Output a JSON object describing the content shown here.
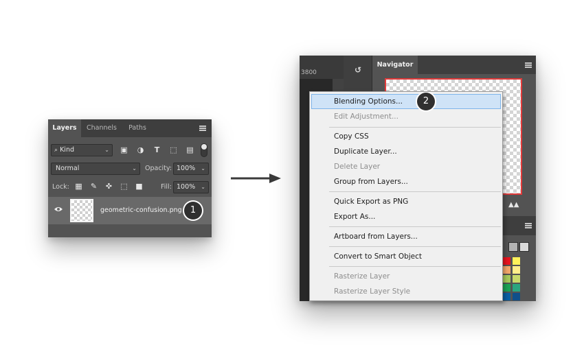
{
  "layers_panel": {
    "tabs": [
      {
        "label": "Layers",
        "active": true
      },
      {
        "label": "Channels",
        "active": false
      },
      {
        "label": "Paths",
        "active": false
      }
    ],
    "kind_filter": {
      "value": "Kind"
    },
    "blend_mode": {
      "value": "Normal"
    },
    "opacity": {
      "label": "Opacity:",
      "value": "100%"
    },
    "lock": {
      "label": "Lock:"
    },
    "fill": {
      "label": "Fill:",
      "value": "100%"
    },
    "layer": {
      "name": "geometric-confusion.png"
    },
    "step_badge": "1"
  },
  "ps_window": {
    "ruler_value": "3800",
    "navigator_tab": "Navigator",
    "swatch_colors": [
      "#e8141e",
      "#fff25a",
      "#f3a66a",
      "#ffee8a",
      "#a6c95b",
      "#c8d96a",
      "#1aa355",
      "#2aa57f",
      "#0a5fa3",
      "#0f4f8a",
      "#0c2f70",
      "#22378f"
    ]
  },
  "context_menu": {
    "items": [
      {
        "label": "Blending Options...",
        "disabled": false,
        "highlighted": true
      },
      {
        "label": "Edit Adjustment...",
        "disabled": true
      },
      {
        "label": "Copy CSS",
        "disabled": false
      },
      {
        "label": "Duplicate Layer...",
        "disabled": false
      },
      {
        "label": "Delete Layer",
        "disabled": true
      },
      {
        "label": "Group from Layers...",
        "disabled": false
      },
      {
        "label": "Quick Export as PNG",
        "disabled": false
      },
      {
        "label": "Export As...",
        "disabled": false
      },
      {
        "label": "Artboard from Layers...",
        "disabled": false
      },
      {
        "label": "Convert to Smart Object",
        "disabled": false
      },
      {
        "label": "Rasterize Layer",
        "disabled": true
      },
      {
        "label": "Rasterize Layer Style",
        "disabled": true
      }
    ],
    "step_badge": "2"
  }
}
